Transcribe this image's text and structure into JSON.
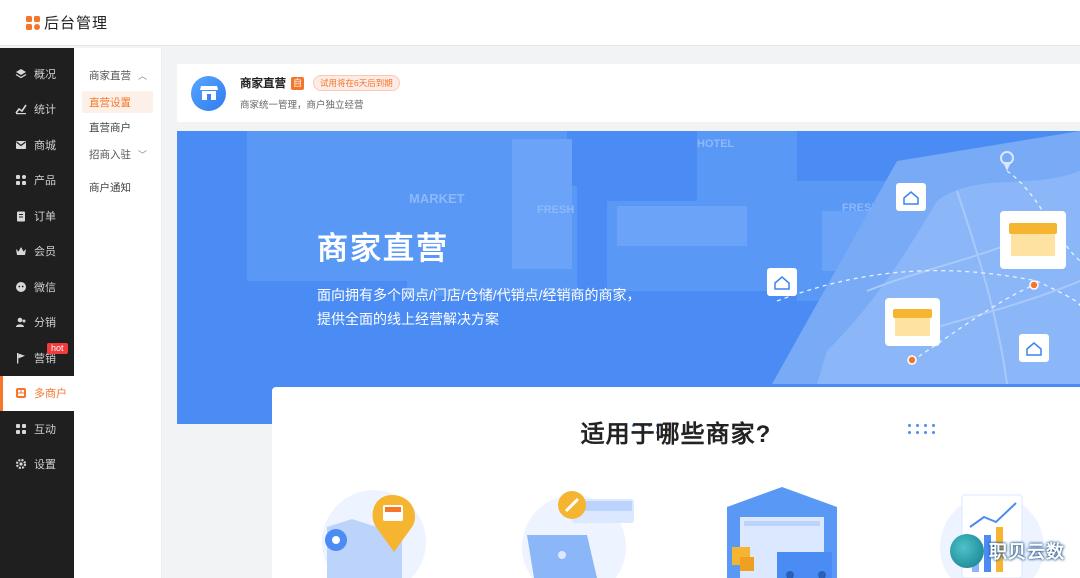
{
  "app": {
    "title": "后台管理"
  },
  "sidebar": {
    "items": [
      {
        "label": "概况",
        "icon": "layers-icon"
      },
      {
        "label": "统计",
        "icon": "chart-icon"
      },
      {
        "label": "商城",
        "icon": "mail-icon"
      },
      {
        "label": "产品",
        "icon": "grid-icon"
      },
      {
        "label": "订单",
        "icon": "clipboard-icon"
      },
      {
        "label": "会员",
        "icon": "crown-icon"
      },
      {
        "label": "微信",
        "icon": "wechat-icon"
      },
      {
        "label": "分销",
        "icon": "users-icon"
      },
      {
        "label": "营销",
        "icon": "flag-icon",
        "badge": "hot"
      },
      {
        "label": "多商户",
        "icon": "store-icon",
        "active": true
      },
      {
        "label": "互动",
        "icon": "apps-icon"
      },
      {
        "label": "设置",
        "icon": "gear-icon"
      }
    ]
  },
  "subnav": {
    "group1": "商家直营",
    "item_settings": "直营设置",
    "item_merchants": "直营商户",
    "group2": "招商入驻",
    "item_notice": "商户通知"
  },
  "header": {
    "title": "商家直营",
    "self_tag": "自",
    "trial": "试用将在6天后到期",
    "subtitle": "商家统一管理，商户独立经营"
  },
  "banner": {
    "title": "商家直营",
    "desc": "面向拥有多个网点/门店/仓储/代销点/经销商的商家，提供全面的线上经营解决方案",
    "sign_market": "MARKET",
    "sign_fresh": "FRESH",
    "sign_hotel": "HOTEL"
  },
  "info": {
    "title": "适用于哪些商家?"
  },
  "watermark": {
    "text": "职贝云数"
  },
  "colors": {
    "accent": "#f5762a",
    "banner": "#4a8cf4",
    "sidebar": "#1f1f1f"
  }
}
